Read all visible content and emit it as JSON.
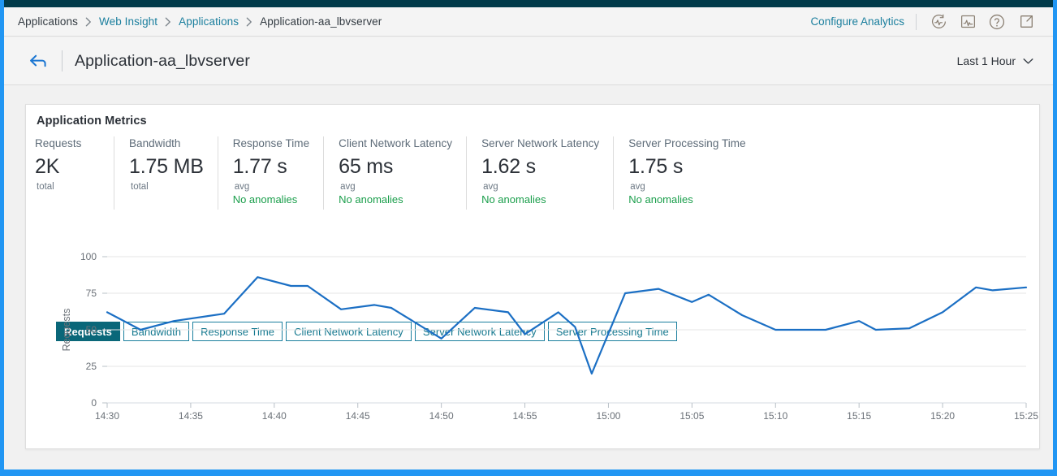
{
  "window": {
    "edge_color": "#2196f3",
    "topbar_color": "#013a4a",
    "page_background": "#f1f1f1"
  },
  "breadcrumb": {
    "items": [
      {
        "label": "Applications",
        "link": false
      },
      {
        "label": "Web Insight",
        "link": true
      },
      {
        "label": "Applications",
        "link": true
      },
      {
        "label": "Application-aa_lbvserver",
        "link": false
      }
    ],
    "separator": "›"
  },
  "header": {
    "configure_analytics_label": "Configure Analytics",
    "icons": [
      {
        "name": "analytics-refresh-icon"
      },
      {
        "name": "chart-box-icon"
      },
      {
        "name": "help-icon"
      },
      {
        "name": "external-link-icon"
      }
    ]
  },
  "title_row": {
    "back_icon": "back-arrow-icon",
    "page_title": "Application-aa_lbvserver",
    "time_range": "Last 1 Hour",
    "time_range_chevron": "chevron-down-icon"
  },
  "card": {
    "title": "Application Metrics",
    "metrics": [
      {
        "label": "Requests",
        "value": "2K",
        "unit": "total",
        "anomaly": ""
      },
      {
        "label": "Bandwidth",
        "value": "1.75 MB",
        "unit": "total",
        "anomaly": ""
      },
      {
        "label": "Response Time",
        "value": "1.77 s",
        "unit": "avg",
        "anomaly": "No anomalies"
      },
      {
        "label": "Client Network Latency",
        "value": "65 ms",
        "unit": "avg",
        "anomaly": "No anomalies"
      },
      {
        "label": "Server Network Latency",
        "value": "1.62 s",
        "unit": "avg",
        "anomaly": "No anomalies"
      },
      {
        "label": "Server Processing Time",
        "value": "1.75 s",
        "unit": "avg",
        "anomaly": "No anomalies"
      }
    ],
    "tabs": [
      {
        "label": "Requests",
        "active": true
      },
      {
        "label": "Bandwidth",
        "active": false
      },
      {
        "label": "Response Time",
        "active": false
      },
      {
        "label": "Client Network Latency",
        "active": false
      },
      {
        "label": "Server Network Latency",
        "active": false
      },
      {
        "label": "Server Processing Time",
        "active": false
      }
    ]
  },
  "colors": {
    "accent_teal": "#0a6779",
    "link_blue": "#1b7f9e",
    "line_blue": "#1b6fc4",
    "anomaly_green": "#1a9e4b"
  },
  "chart_data": {
    "type": "line",
    "title": "",
    "xlabel": "",
    "ylabel": "Requests",
    "ylim": [
      0,
      100
    ],
    "yticks": [
      0,
      25,
      50,
      75,
      100
    ],
    "xticks": [
      "14:30",
      "14:35",
      "14:40",
      "14:45",
      "14:50",
      "14:55",
      "15:00",
      "15:05",
      "15:10",
      "15:15",
      "15:20",
      "15:25"
    ],
    "grid": true,
    "legend": false,
    "line_color": "#1b6fc4",
    "series": [
      {
        "name": "Requests",
        "x": [
          "14:30",
          "14:32",
          "14:34",
          "14:36",
          "14:38",
          "14:40",
          "14:42",
          "14:44",
          "14:46",
          "14:48",
          "14:50",
          "14:52",
          "14:54",
          "14:56",
          "14:58",
          "15:00",
          "15:02",
          "15:04",
          "15:06",
          "15:08",
          "15:10",
          "15:12",
          "15:14",
          "15:16",
          "15:18",
          "15:20",
          "15:22",
          "15:24",
          "15:25"
        ],
        "values": [
          62,
          50,
          56,
          61,
          86,
          80,
          80,
          64,
          67,
          65,
          44,
          58,
          65,
          63,
          47,
          62,
          52,
          20,
          75,
          78,
          69,
          74,
          62,
          55,
          50,
          50,
          50,
          56,
          50,
          51,
          62,
          79,
          77,
          79
        ]
      }
    ],
    "points": [
      {
        "t": "14:30",
        "v": 62
      },
      {
        "t": "14:32",
        "v": 50
      },
      {
        "t": "14:34",
        "v": 56
      },
      {
        "t": "14:37",
        "v": 61
      },
      {
        "t": "14:39",
        "v": 86
      },
      {
        "t": "14:41",
        "v": 80
      },
      {
        "t": "14:42",
        "v": 80
      },
      {
        "t": "14:44",
        "v": 64
      },
      {
        "t": "14:46",
        "v": 67
      },
      {
        "t": "14:47",
        "v": 65
      },
      {
        "t": "14:50",
        "v": 44
      },
      {
        "t": "14:52",
        "v": 65
      },
      {
        "t": "14:54",
        "v": 62
      },
      {
        "t": "14:55",
        "v": 47
      },
      {
        "t": "14:57",
        "v": 62
      },
      {
        "t": "14:58",
        "v": 52
      },
      {
        "t": "14:59",
        "v": 20
      },
      {
        "t": "15:01",
        "v": 75
      },
      {
        "t": "15:03",
        "v": 78
      },
      {
        "t": "15:05",
        "v": 69
      },
      {
        "t": "15:06",
        "v": 74
      },
      {
        "t": "15:08",
        "v": 60
      },
      {
        "t": "15:10",
        "v": 50
      },
      {
        "t": "15:13",
        "v": 50
      },
      {
        "t": "15:15",
        "v": 56
      },
      {
        "t": "15:16",
        "v": 50
      },
      {
        "t": "15:18",
        "v": 51
      },
      {
        "t": "15:20",
        "v": 62
      },
      {
        "t": "15:22",
        "v": 79
      },
      {
        "t": "15:23",
        "v": 77
      },
      {
        "t": "15:25",
        "v": 79
      }
    ]
  }
}
